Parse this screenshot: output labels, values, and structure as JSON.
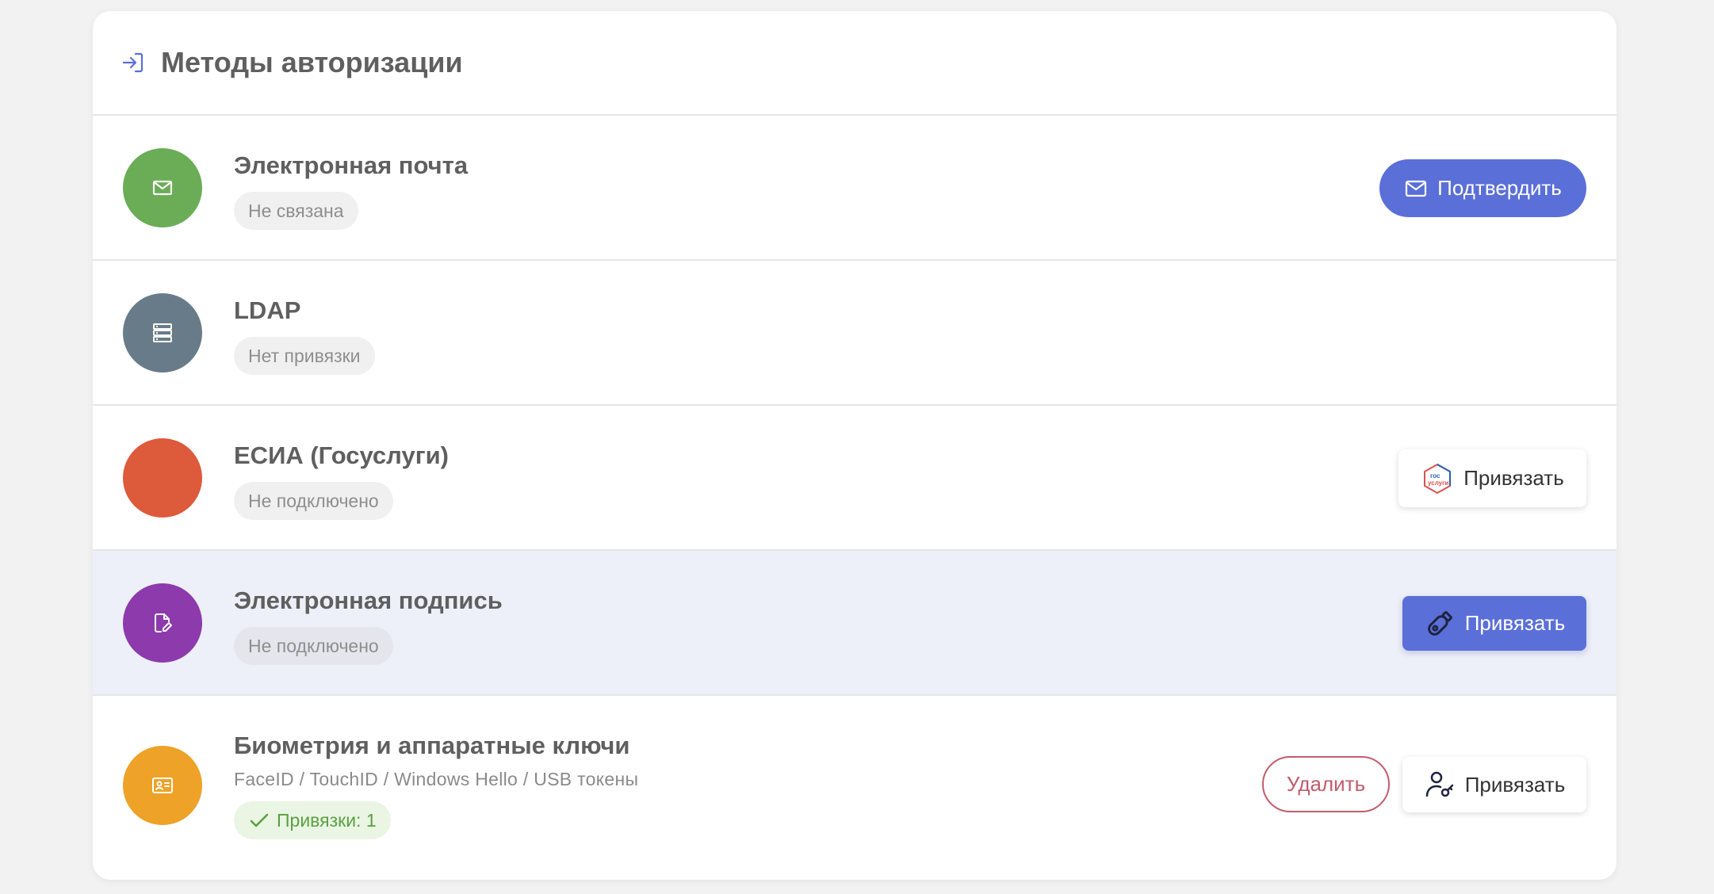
{
  "header": {
    "title": "Методы авторизации",
    "icon": "login-icon"
  },
  "colors": {
    "accent": "#5b6fd8",
    "email": "#6aad56",
    "ldap": "#687b88",
    "esia": "#dd5a3b",
    "signature": "#8d3aad",
    "biometric": "#eea227",
    "danger": "#c25b6c",
    "success": "#5aa042"
  },
  "methods": [
    {
      "title": "Электронная почта",
      "icon": "mail-icon",
      "status": "Не связана",
      "action_label": "Подтвердить"
    },
    {
      "title": "LDAP",
      "icon": "server-icon",
      "status": "Нет привязки"
    },
    {
      "title": "ЕСИА (Госуслуги)",
      "status": "Не подключено",
      "action_label": "Привязать",
      "logo_text": [
        "гос",
        "услуги"
      ]
    },
    {
      "title": "Электронная подпись",
      "icon": "document-sign-icon",
      "status": "Не подключено",
      "action_label": "Привязать"
    },
    {
      "title": "Биометрия и аппаратные ключи",
      "icon": "id-card-icon",
      "subtitle": "FaceID / TouchID / Windows Hello / USB токены",
      "status": "Привязки: 1",
      "delete_label": "Удалить",
      "action_label": "Привязать"
    }
  ]
}
